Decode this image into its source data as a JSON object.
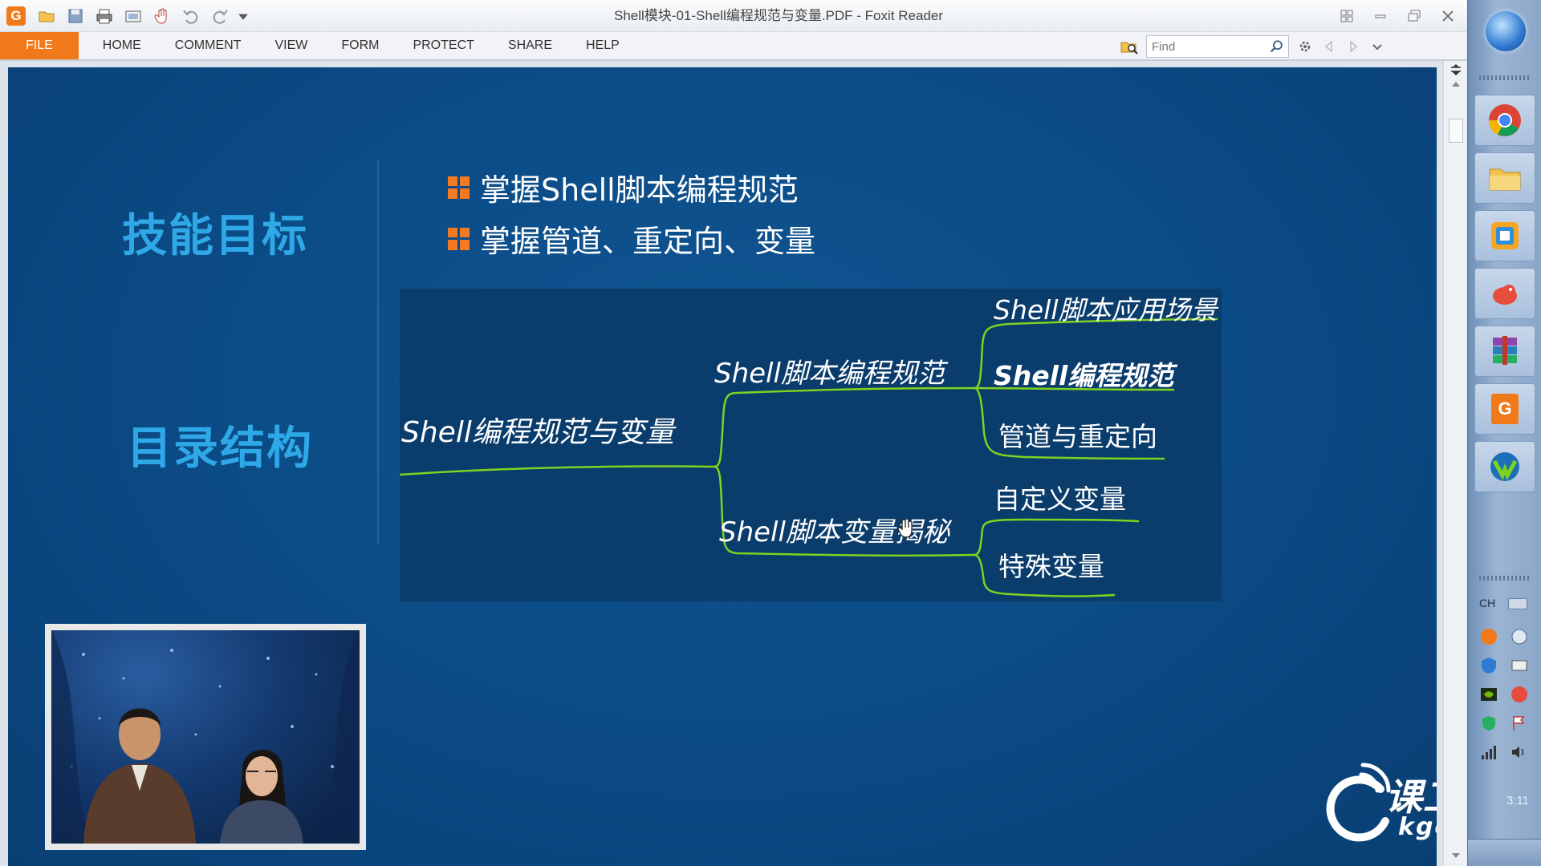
{
  "window": {
    "title": "Shell模块-01-Shell编程规范与变量.PDF - Foxit Reader"
  },
  "menu": {
    "tabs": [
      "FILE",
      "HOME",
      "COMMENT",
      "VIEW",
      "FORM",
      "PROTECT",
      "SHARE",
      "HELP"
    ]
  },
  "find": {
    "placeholder": "Find"
  },
  "slide": {
    "skill_heading": "技能目标",
    "goals": [
      "掌握Shell脚本编程规范",
      "掌握管道、重定向、变量"
    ],
    "toc_heading": "目录结构",
    "mindmap": {
      "root": "Shell编程规范与变量",
      "branches": [
        {
          "label": "Shell脚本编程规范",
          "children": [
            "Shell脚本应用场景",
            "Shell编程规范",
            "管道与重定向"
          ]
        },
        {
          "label": "Shell脚本变量揭秘",
          "children": [
            "自定义变量",
            "特殊变量"
          ]
        }
      ]
    },
    "brand": {
      "name": "课工场",
      "domain": "kgc.cn"
    }
  },
  "taskbar": {
    "tray_lang": "CH",
    "clock": "3:11"
  },
  "colors": {
    "accent_orange": "#f07a1a",
    "slide_blue": "#0b4a84",
    "heading_blue": "#2ea8e6",
    "mindmap_line": "#7ed321"
  }
}
